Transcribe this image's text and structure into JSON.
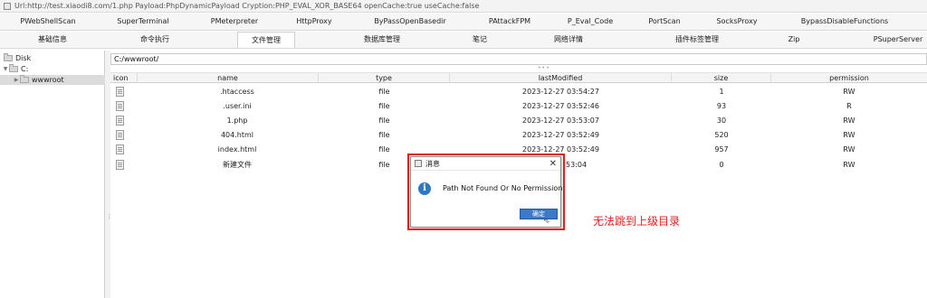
{
  "window": {
    "title": "Url:http://test.xiaodi8.com/1.php Payload:PhpDynamicPayload Cryption:PHP_EVAL_XOR_BASE64 openCache:true useCache:false"
  },
  "tabs_row1": [
    {
      "label": "PWebShellScan"
    },
    {
      "label": "SuperTerminal"
    },
    {
      "label": "PMeterpreter"
    },
    {
      "label": "HttpProxy"
    },
    {
      "label": "ByPassOpenBasedir"
    },
    {
      "label": "PAttackFPM"
    },
    {
      "label": "P_Eval_Code"
    },
    {
      "label": "PortScan"
    },
    {
      "label": "SocksProxy"
    },
    {
      "label": "BypassDisableFunctions"
    }
  ],
  "tabs_row2": [
    {
      "label": "基础信息"
    },
    {
      "label": "命令执行"
    },
    {
      "label": "文件管理"
    },
    {
      "label": "数据库管理"
    },
    {
      "label": "笔记"
    },
    {
      "label": "网络详情"
    },
    {
      "label": "插件标签管理"
    },
    {
      "label": "Zip"
    },
    {
      "label": "PSuperServer"
    }
  ],
  "tree": {
    "root": "Disk",
    "drive": "C:",
    "folder": "wwwroot"
  },
  "path": {
    "value": "C:/wwwroot/"
  },
  "table": {
    "columns": {
      "icon": "icon",
      "name": "name",
      "type": "type",
      "lastModified": "lastModified",
      "size": "size",
      "permission": "permission"
    },
    "rows": [
      {
        "name": ".htaccess",
        "type": "file",
        "lastModified": "2023-12-27 03:54:27",
        "size": "1",
        "permission": "RW"
      },
      {
        "name": ".user.ini",
        "type": "file",
        "lastModified": "2023-12-27 03:52:46",
        "size": "93",
        "permission": "R"
      },
      {
        "name": "1.php",
        "type": "file",
        "lastModified": "2023-12-27 03:53:07",
        "size": "30",
        "permission": "RW"
      },
      {
        "name": "404.html",
        "type": "file",
        "lastModified": "2023-12-27 03:52:49",
        "size": "520",
        "permission": "RW"
      },
      {
        "name": "index.html",
        "type": "file",
        "lastModified": "2023-12-27 03:52:49",
        "size": "957",
        "permission": "RW"
      },
      {
        "name": "新建文件",
        "type": "file",
        "lastModified": "53:04",
        "size": "0",
        "permission": "RW"
      }
    ]
  },
  "dialog": {
    "title": "消息",
    "message": "Path Not Found Or No Permission!",
    "ok_label": "确定"
  },
  "annotation": {
    "text": "无法跳到上级目录"
  },
  "colors": {
    "annotation_red": "#e02020",
    "ok_button_blue": "#3c7ac7",
    "info_icon_blue": "#2f78c4"
  }
}
